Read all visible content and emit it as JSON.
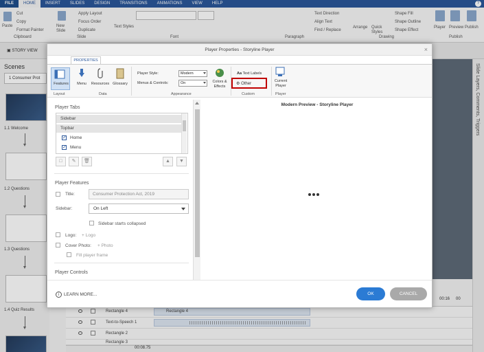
{
  "app": {
    "tabs": [
      "FILE",
      "HOME",
      "INSERT",
      "SLIDES",
      "DESIGN",
      "TRANSITIONS",
      "ANIMATIONS",
      "VIEW",
      "HELP"
    ],
    "active_tab": "HOME",
    "ribbon": {
      "paste": "Paste",
      "cut": "Cut",
      "copy": "Copy",
      "format_painter": "Format Painter",
      "clipboard": "Clipboard",
      "new_slide": "New Slide",
      "apply_layout": "Apply Layout",
      "focus_order": "Focus Order",
      "duplicate": "Duplicate",
      "slide": "Slide",
      "text_styles": "Text Styles",
      "font": "Font",
      "text_direction": "Text Direction",
      "align_text": "Align Text",
      "find_replace": "Find / Replace",
      "paragraph": "Paragraph",
      "arrange": "Arrange",
      "quick_styles": "Quick Styles",
      "shape_fill": "Shape Fill",
      "shape_outline": "Shape Outline",
      "shape_effect": "Shape Effect",
      "drawing": "Drawing",
      "player": "Player",
      "preview": "Preview",
      "publish_btn": "Publish",
      "publish_group": "Publish"
    },
    "story_view": "STORY VIEW",
    "scenes_title": "Scenes",
    "scene_select": "1 Consumer Prot",
    "scenes": [
      "1.1 Welcome",
      "1.2 Questions",
      "1.3 Questions",
      "1.4 Quiz Results"
    ],
    "right_strip": "Slide Layers, Comments, Triggers",
    "timeline": {
      "rows": [
        {
          "label": "Rectangle 4",
          "bar": "Rectangle 4"
        },
        {
          "label": "Text-to-Speech 1",
          "bar": ""
        },
        {
          "label": "Rectangle 2",
          "bar": ""
        },
        {
          "label": "Rectangle 3",
          "bar": ""
        }
      ],
      "time_left": "00:16",
      "time_right": "00",
      "playhead": "00:08.75"
    }
  },
  "dialog": {
    "title": "Player Properties - Storyline Player",
    "close": "×",
    "tab": "PROPERTIES",
    "ribbon": {
      "features": "Features",
      "menu": "Menu",
      "resources": "Resources",
      "glossary": "Glossary",
      "layout_group": "Layout",
      "data_group": "Data",
      "player_style_label": "Player Style:",
      "player_style_value": "Modern",
      "menus_controls_label": "Menus & Controls:",
      "menus_controls_value": "On",
      "appearance_group": "Appearance",
      "colors_effects": "Colors & Effects",
      "text_labels": "Text Labels",
      "other": "Other",
      "custom_group": "Custom",
      "current_player": "Current Player",
      "player_group": "Player"
    },
    "player_tabs": {
      "title": "Player Tabs",
      "items": [
        {
          "label": "Sidebar",
          "checked": null
        },
        {
          "label": "Topbar",
          "checked": null
        },
        {
          "label": "Home",
          "checked": true
        },
        {
          "label": "Menu",
          "checked": true
        }
      ]
    },
    "player_features": {
      "title": "Player Features",
      "title_label": "Title:",
      "title_value": "Consumer Protection Act, 2019",
      "sidebar_label": "Sidebar:",
      "sidebar_value": "On Left",
      "sidebar_collapsed": "Sidebar starts collapsed",
      "logo_label": "Logo:",
      "logo_add": "+ Logo",
      "cover_label": "Cover Photo:",
      "cover_add": "+ Photo",
      "fill_frame": "Fill player frame"
    },
    "player_controls_title": "Player Controls",
    "preview_title": "Modern Preview - Storyline Player",
    "footer": {
      "learn_more": "LEARN MORE...",
      "ok": "OK",
      "cancel": "CANCEL"
    }
  }
}
